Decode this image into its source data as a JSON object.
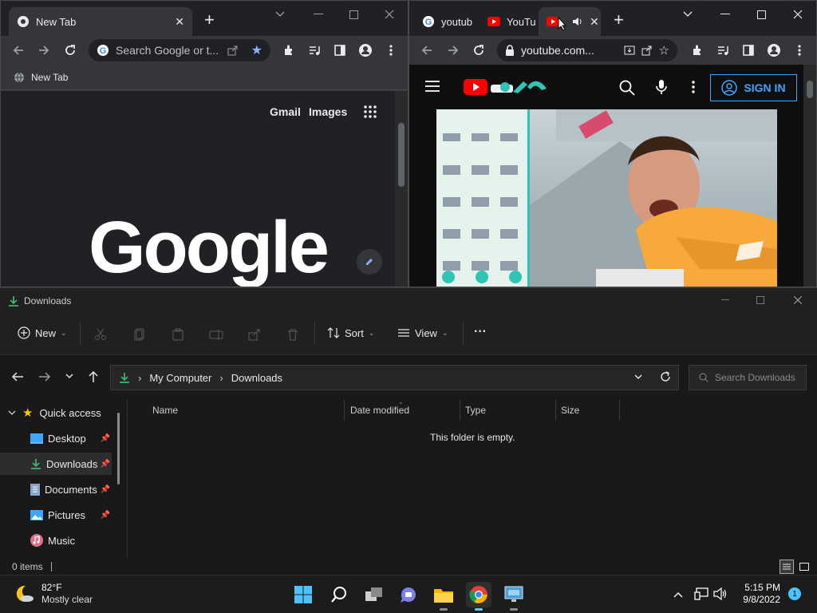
{
  "chrome_left": {
    "tab_title": "New Tab",
    "omnibox_placeholder": "Search Google or t...",
    "bookmark_label": "New Tab",
    "ntp": {
      "gmail": "Gmail",
      "images": "Images",
      "logo": "Google"
    }
  },
  "chrome_right": {
    "tabs": [
      {
        "label": "youtub"
      },
      {
        "label": "YouTu"
      },
      {
        "label": ""
      }
    ],
    "url": "youtube.com...",
    "signin_label": "SIGN IN"
  },
  "explorer": {
    "window_title": "Downloads",
    "commands": {
      "new": "New",
      "sort": "Sort",
      "view": "View",
      "more": "···"
    },
    "breadcrumb": [
      "My Computer",
      "Downloads"
    ],
    "search_placeholder": "Search Downloads",
    "nav": [
      {
        "label": "Quick access",
        "pinned": false
      },
      {
        "label": "Desktop",
        "pinned": true
      },
      {
        "label": "Downloads",
        "pinned": true
      },
      {
        "label": "Documents",
        "pinned": true
      },
      {
        "label": "Pictures",
        "pinned": true
      },
      {
        "label": "Music",
        "pinned": false
      }
    ],
    "columns": [
      "Name",
      "Date modified",
      "Type",
      "Size"
    ],
    "empty_message": "This folder is empty.",
    "status": "0 items"
  },
  "taskbar": {
    "weather_temp": "82°F",
    "weather_desc": "Mostly clear",
    "time": "5:15 PM",
    "date": "9/8/2022",
    "notification_count": "1"
  },
  "colors": {
    "accent_blue": "#3ea6ff",
    "youtube_red": "#ff0000",
    "downloads_green": "#3cb371",
    "quick_access_yellow": "#f5c518"
  }
}
